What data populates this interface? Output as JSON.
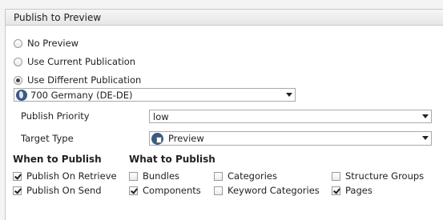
{
  "panel": {
    "title": "Publish to Preview"
  },
  "options": {
    "no_preview": "No Preview",
    "use_current": "Use Current Publication",
    "use_different": "Use Different Publication"
  },
  "publication_select": {
    "value": "700 Germany (DE-DE)"
  },
  "priority": {
    "label": "Publish Priority",
    "value": "low"
  },
  "target": {
    "label": "Target Type",
    "value": "Preview"
  },
  "when": {
    "heading": "When to Publish",
    "retrieve": "Publish On Retrieve",
    "send": "Publish On Send"
  },
  "what": {
    "heading": "What to Publish",
    "bundles": "Bundles",
    "components": "Components",
    "categories": "Categories",
    "keyword_categories": "Keyword Categories",
    "structure_groups": "Structure Groups",
    "pages": "Pages"
  }
}
